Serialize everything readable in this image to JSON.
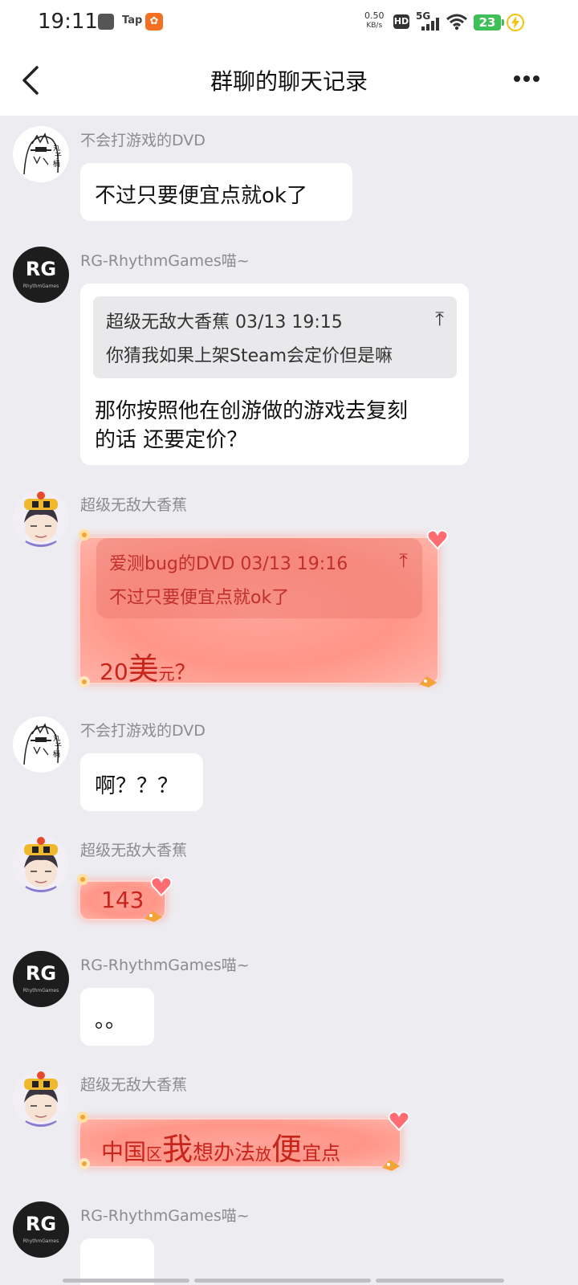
{
  "status_bar": {
    "time": "19:11",
    "tap_label": "Tap",
    "net_speed_value": "0.50",
    "net_speed_unit": "KB/s",
    "hd_label": "HD",
    "network_label": "5G",
    "battery_level": "23"
  },
  "header": {
    "title": "群聊的聊天记录"
  },
  "messages": [
    {
      "sender": "不会打游戏的DVD",
      "text": "不过只要便宜点就ok了"
    },
    {
      "sender": "RG-RhythmGames喵~",
      "quote_head": "超级无敌大香蕉 03/13 19:15",
      "quote_body": "你猜我如果上架Steam会定价但是嘛",
      "text_line1": "那你按照他在创游做的游戏去复刻",
      "text_line2": "的话 还要定价？"
    },
    {
      "sender": "超级无敌大香蕉",
      "quote_head": "爱测bug的DVD 03/13 19:16",
      "quote_body": "不过只要便宜点就ok了",
      "t1": "20",
      "t2": "美",
      "t3": "元",
      "t4": "？"
    },
    {
      "sender": "不会打游戏的DVD",
      "text": "啊？？？"
    },
    {
      "sender": "超级无敌大香蕉",
      "text": "143"
    },
    {
      "sender": "RG-RhythmGames喵~",
      "text": "。。"
    },
    {
      "sender": "超级无敌大香蕉",
      "s1": "中国",
      "s2": "区",
      "s3": "我",
      "s4": "想办法",
      "s5": "放",
      "s6": "便",
      "s7": "宜点"
    },
    {
      "sender": "RG-RhythmGames喵~",
      "text": ""
    }
  ],
  "avatars": {
    "rg_big": "RG",
    "rg_small": "RhythmGames"
  },
  "colors": {
    "accent_red": "#c7241c",
    "bubble_white": "#ffffff",
    "background": "#ededf1"
  }
}
